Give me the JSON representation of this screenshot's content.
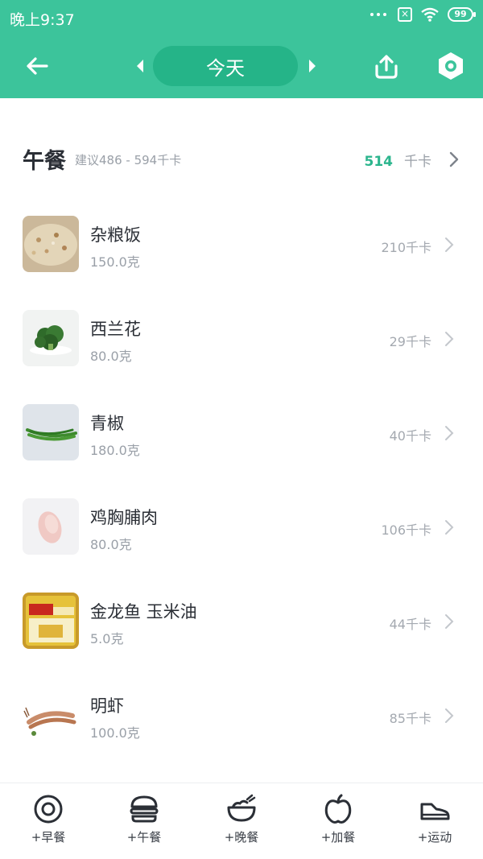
{
  "status_bar": {
    "time": "晚上9:37",
    "battery": "99"
  },
  "header": {
    "date_label": "今天"
  },
  "meal": {
    "title": "午餐",
    "suggestion": "建议486 - 594千卡",
    "total_kcal": "514",
    "kcal_unit": "千卡"
  },
  "foods": [
    {
      "name": "杂粮饭",
      "amount": "150.0克",
      "kcal": "210千卡",
      "thumb_icon": "rice-photo"
    },
    {
      "name": "西兰花",
      "amount": "80.0克",
      "kcal": "29千卡",
      "thumb_icon": "broccoli-photo"
    },
    {
      "name": "青椒",
      "amount": "180.0克",
      "kcal": "40千卡",
      "thumb_icon": "green-pepper-photo"
    },
    {
      "name": "鸡胸脯肉",
      "amount": "80.0克",
      "kcal": "106千卡",
      "thumb_icon": "chicken-breast-photo"
    },
    {
      "name": "金龙鱼 玉米油",
      "amount": "5.0克",
      "kcal": "44千卡",
      "thumb_icon": "corn-oil-photo"
    },
    {
      "name": "明虾",
      "amount": "100.0克",
      "kcal": "85千卡",
      "thumb_icon": "shrimp-photo"
    }
  ],
  "bottom_nav": [
    {
      "label": "+早餐",
      "icon": "egg-icon"
    },
    {
      "label": "+午餐",
      "icon": "burger-icon"
    },
    {
      "label": "+晚餐",
      "icon": "bowl-icon"
    },
    {
      "label": "+加餐",
      "icon": "apple-icon"
    },
    {
      "label": "+运动",
      "icon": "shoe-icon"
    }
  ],
  "colors": {
    "brand": "#3cc49b",
    "pill": "#25b488",
    "accent_kcal": "#2bb58d"
  }
}
